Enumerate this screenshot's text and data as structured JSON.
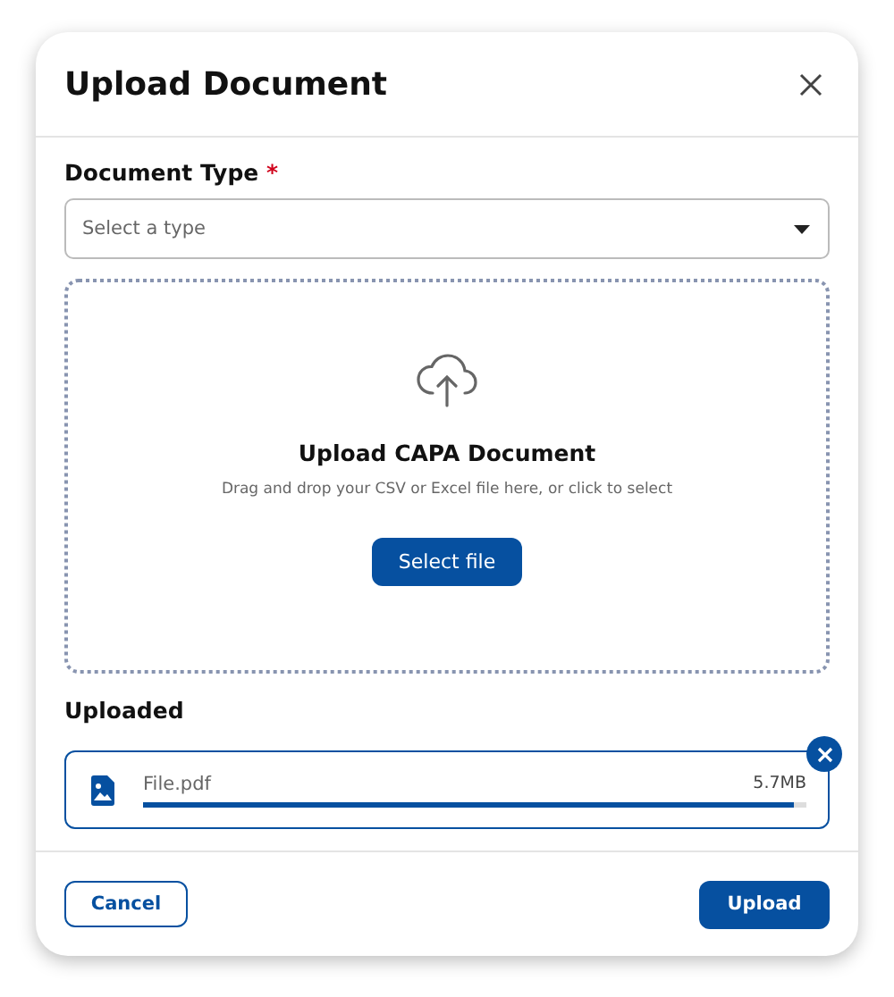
{
  "dialog": {
    "title": "Upload Document"
  },
  "document_type": {
    "label": "Document Type",
    "required": true,
    "required_mark": "*",
    "placeholder": "Select a type"
  },
  "dropzone": {
    "title": "Upload CAPA Document",
    "hint": "Drag and drop your CSV or Excel file here, or click to select",
    "button": "Select file"
  },
  "uploaded": {
    "label": "Uploaded",
    "files": [
      {
        "name": "File.pdf",
        "size": "5.7MB",
        "level": 0.98
      }
    ]
  },
  "footer": {
    "cancel": "Cancel",
    "submit": "Upload"
  }
}
